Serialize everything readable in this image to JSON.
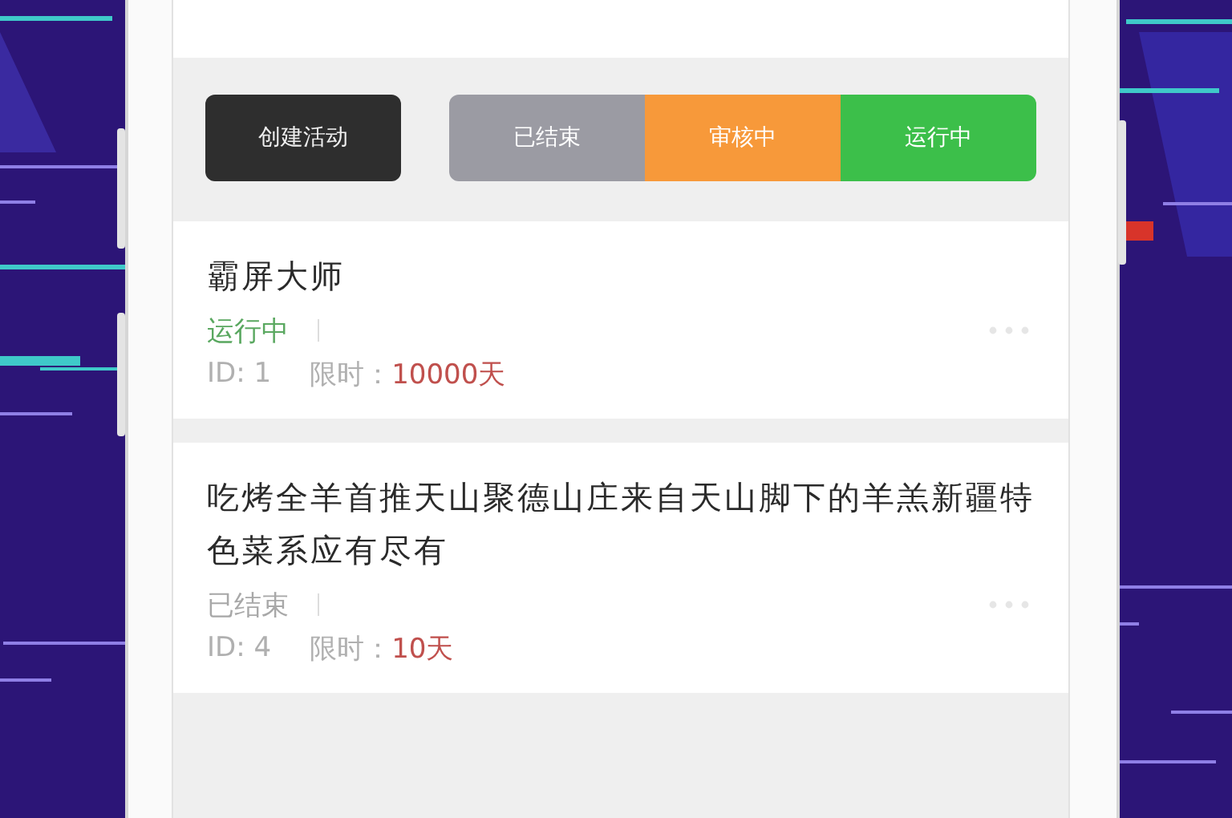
{
  "create_button": {
    "label": "创建活动"
  },
  "status_filters": [
    {
      "label": "已结束",
      "color": "#9b9ba3"
    },
    {
      "label": "审核中",
      "color": "#f7993a"
    },
    {
      "label": "运行中",
      "color": "#3cbf4a"
    }
  ],
  "activities": [
    {
      "title": "霸屏大师",
      "status": "运行中",
      "color": "#5aa860",
      "id": "ID: 1",
      "limit_label": "限时：",
      "limit": "10000天"
    },
    {
      "title": "吃烤全羊首推天山聚德山庄来自天山脚下的羊羔新疆特色菜系应有尽有",
      "status": "已结束",
      "color": "#a8a8a8",
      "id": "ID: 4",
      "limit_label": "限时：",
      "limit": "10天"
    }
  ]
}
